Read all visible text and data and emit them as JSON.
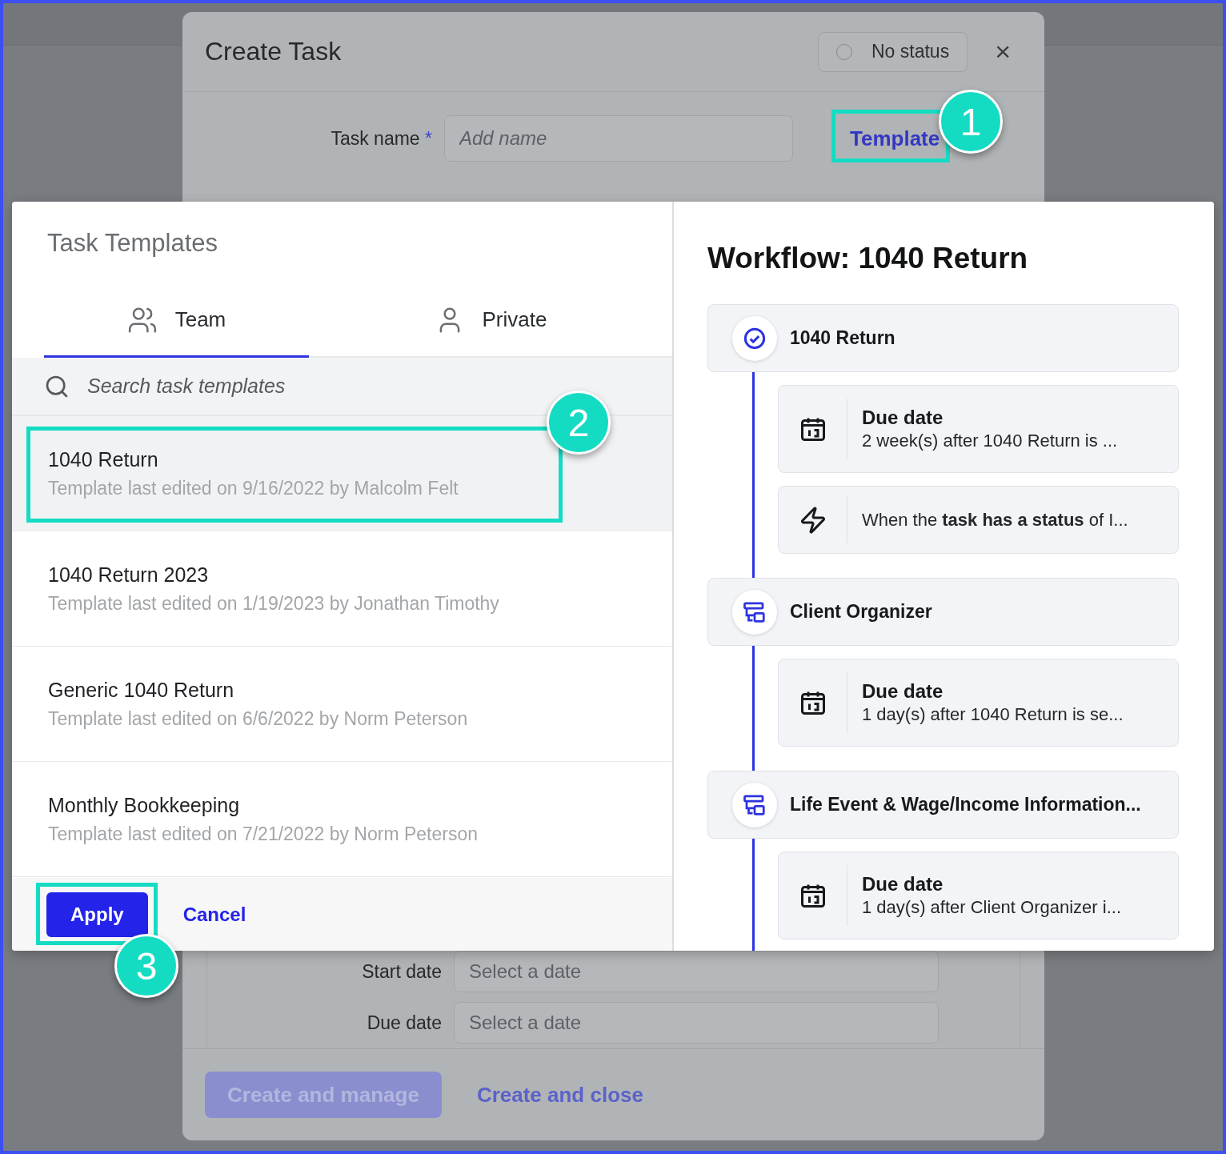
{
  "create_task": {
    "title": "Create Task",
    "status": {
      "label": "No status"
    },
    "close": "×",
    "task_name": {
      "label": "Task name",
      "required_mark": "*",
      "placeholder": "Add name"
    },
    "template_link": "Template",
    "fields": [
      {
        "label": "Start date",
        "placeholder": "Select a date"
      },
      {
        "label": "Due date",
        "placeholder": "Select a date"
      }
    ],
    "buttons": [
      {
        "label": "Create and manage",
        "kind": "primary",
        "disabled": true
      },
      {
        "label": "Create and close",
        "kind": "link",
        "disabled": false
      }
    ]
  },
  "templates_panel": {
    "title": "Task Templates",
    "tabs": [
      {
        "label": "Team",
        "kind": "team",
        "selected": true
      },
      {
        "label": "Private",
        "kind": "private",
        "selected": false
      }
    ],
    "search": {
      "placeholder": "Search task templates"
    },
    "templates": [
      {
        "name": "1040 Return",
        "meta": "Template last edited on 9/16/2022 by Malcolm Felt",
        "selected": true
      },
      {
        "name": "1040 Return 2023",
        "meta": "Template last edited on 1/19/2023 by Jonathan Timothy",
        "selected": false
      },
      {
        "name": "Generic 1040 Return",
        "meta": "Template last edited on 6/6/2022 by Norm Peterson",
        "selected": false
      },
      {
        "name": "Monthly Bookkeeping",
        "meta": "Template last edited on 7/21/2022 by Norm Peterson",
        "selected": false
      }
    ],
    "buttons": [
      {
        "label": "Apply",
        "kind": "primary"
      },
      {
        "label": "Cancel",
        "kind": "link"
      }
    ]
  },
  "workflow": {
    "title": "Workflow: 1040 Return",
    "steps": [
      {
        "kind": "task",
        "name": "1040 Return",
        "actions": [
          {
            "kind": "due_date",
            "title": "Due date",
            "text": "2 week(s) after 1040 Return is ..."
          },
          {
            "kind": "trigger",
            "text": "When the **task has a status** of I..."
          }
        ]
      },
      {
        "kind": "organizer",
        "name": "Client Organizer",
        "actions": [
          {
            "kind": "due_date",
            "title": "Due date",
            "text": "1 day(s) after 1040 Return is se..."
          }
        ]
      },
      {
        "kind": "organizer",
        "name": "Life Event & Wage/Income Information...",
        "actions": [
          {
            "kind": "due_date",
            "title": "Due date",
            "text": "1 day(s) after Client Organizer i..."
          }
        ]
      }
    ]
  },
  "callouts": [
    {
      "label": "1"
    },
    {
      "label": "2"
    },
    {
      "label": "3"
    }
  ]
}
